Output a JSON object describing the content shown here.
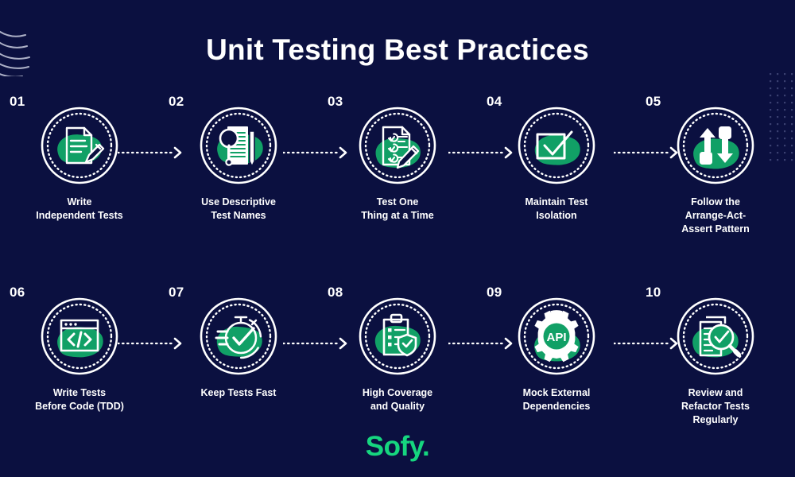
{
  "title": "Unit Testing Best Practices",
  "brand": {
    "logo_text": "Sofy.",
    "logo_color": "#16d67f"
  },
  "colors": {
    "background": "#0b1040",
    "green": "#11a066",
    "white": "#ffffff",
    "logo_green": "#16d67f"
  },
  "decor": {
    "waves": "wave-lines-decoration",
    "dots": "dot-grid-decoration",
    "connector": "dotted-arrow"
  },
  "rows": [
    {
      "steps": [
        {
          "number": "01",
          "label": "Write\nIndependent Tests",
          "icon": "document-pencil-icon"
        },
        {
          "number": "02",
          "label": "Use Descriptive\nTest Names",
          "icon": "document-magnifier-pencil-icon"
        },
        {
          "number": "03",
          "label": "Test One\nThing at a Time",
          "icon": "checklist-pencil-icon"
        },
        {
          "number": "04",
          "label": "Maintain Test\nIsolation",
          "icon": "checkbox-check-icon"
        },
        {
          "number": "05",
          "label": "Follow the\nArrange-Act-\nAssert Pattern",
          "icon": "arrows-squares-icon"
        }
      ]
    },
    {
      "steps": [
        {
          "number": "06",
          "label": "Write Tests\nBefore Code (TDD)",
          "icon": "code-window-icon"
        },
        {
          "number": "07",
          "label": "Keep Tests Fast",
          "icon": "stopwatch-check-icon"
        },
        {
          "number": "08",
          "label": "High Coverage\nand Quality",
          "icon": "clipboard-shield-icon"
        },
        {
          "number": "09",
          "label": "Mock External\nDependencies",
          "icon": "gear-api-icon"
        },
        {
          "number": "10",
          "label": "Review and\nRefactor Tests\nRegularly",
          "icon": "documents-magnifier-check-icon"
        }
      ]
    }
  ]
}
